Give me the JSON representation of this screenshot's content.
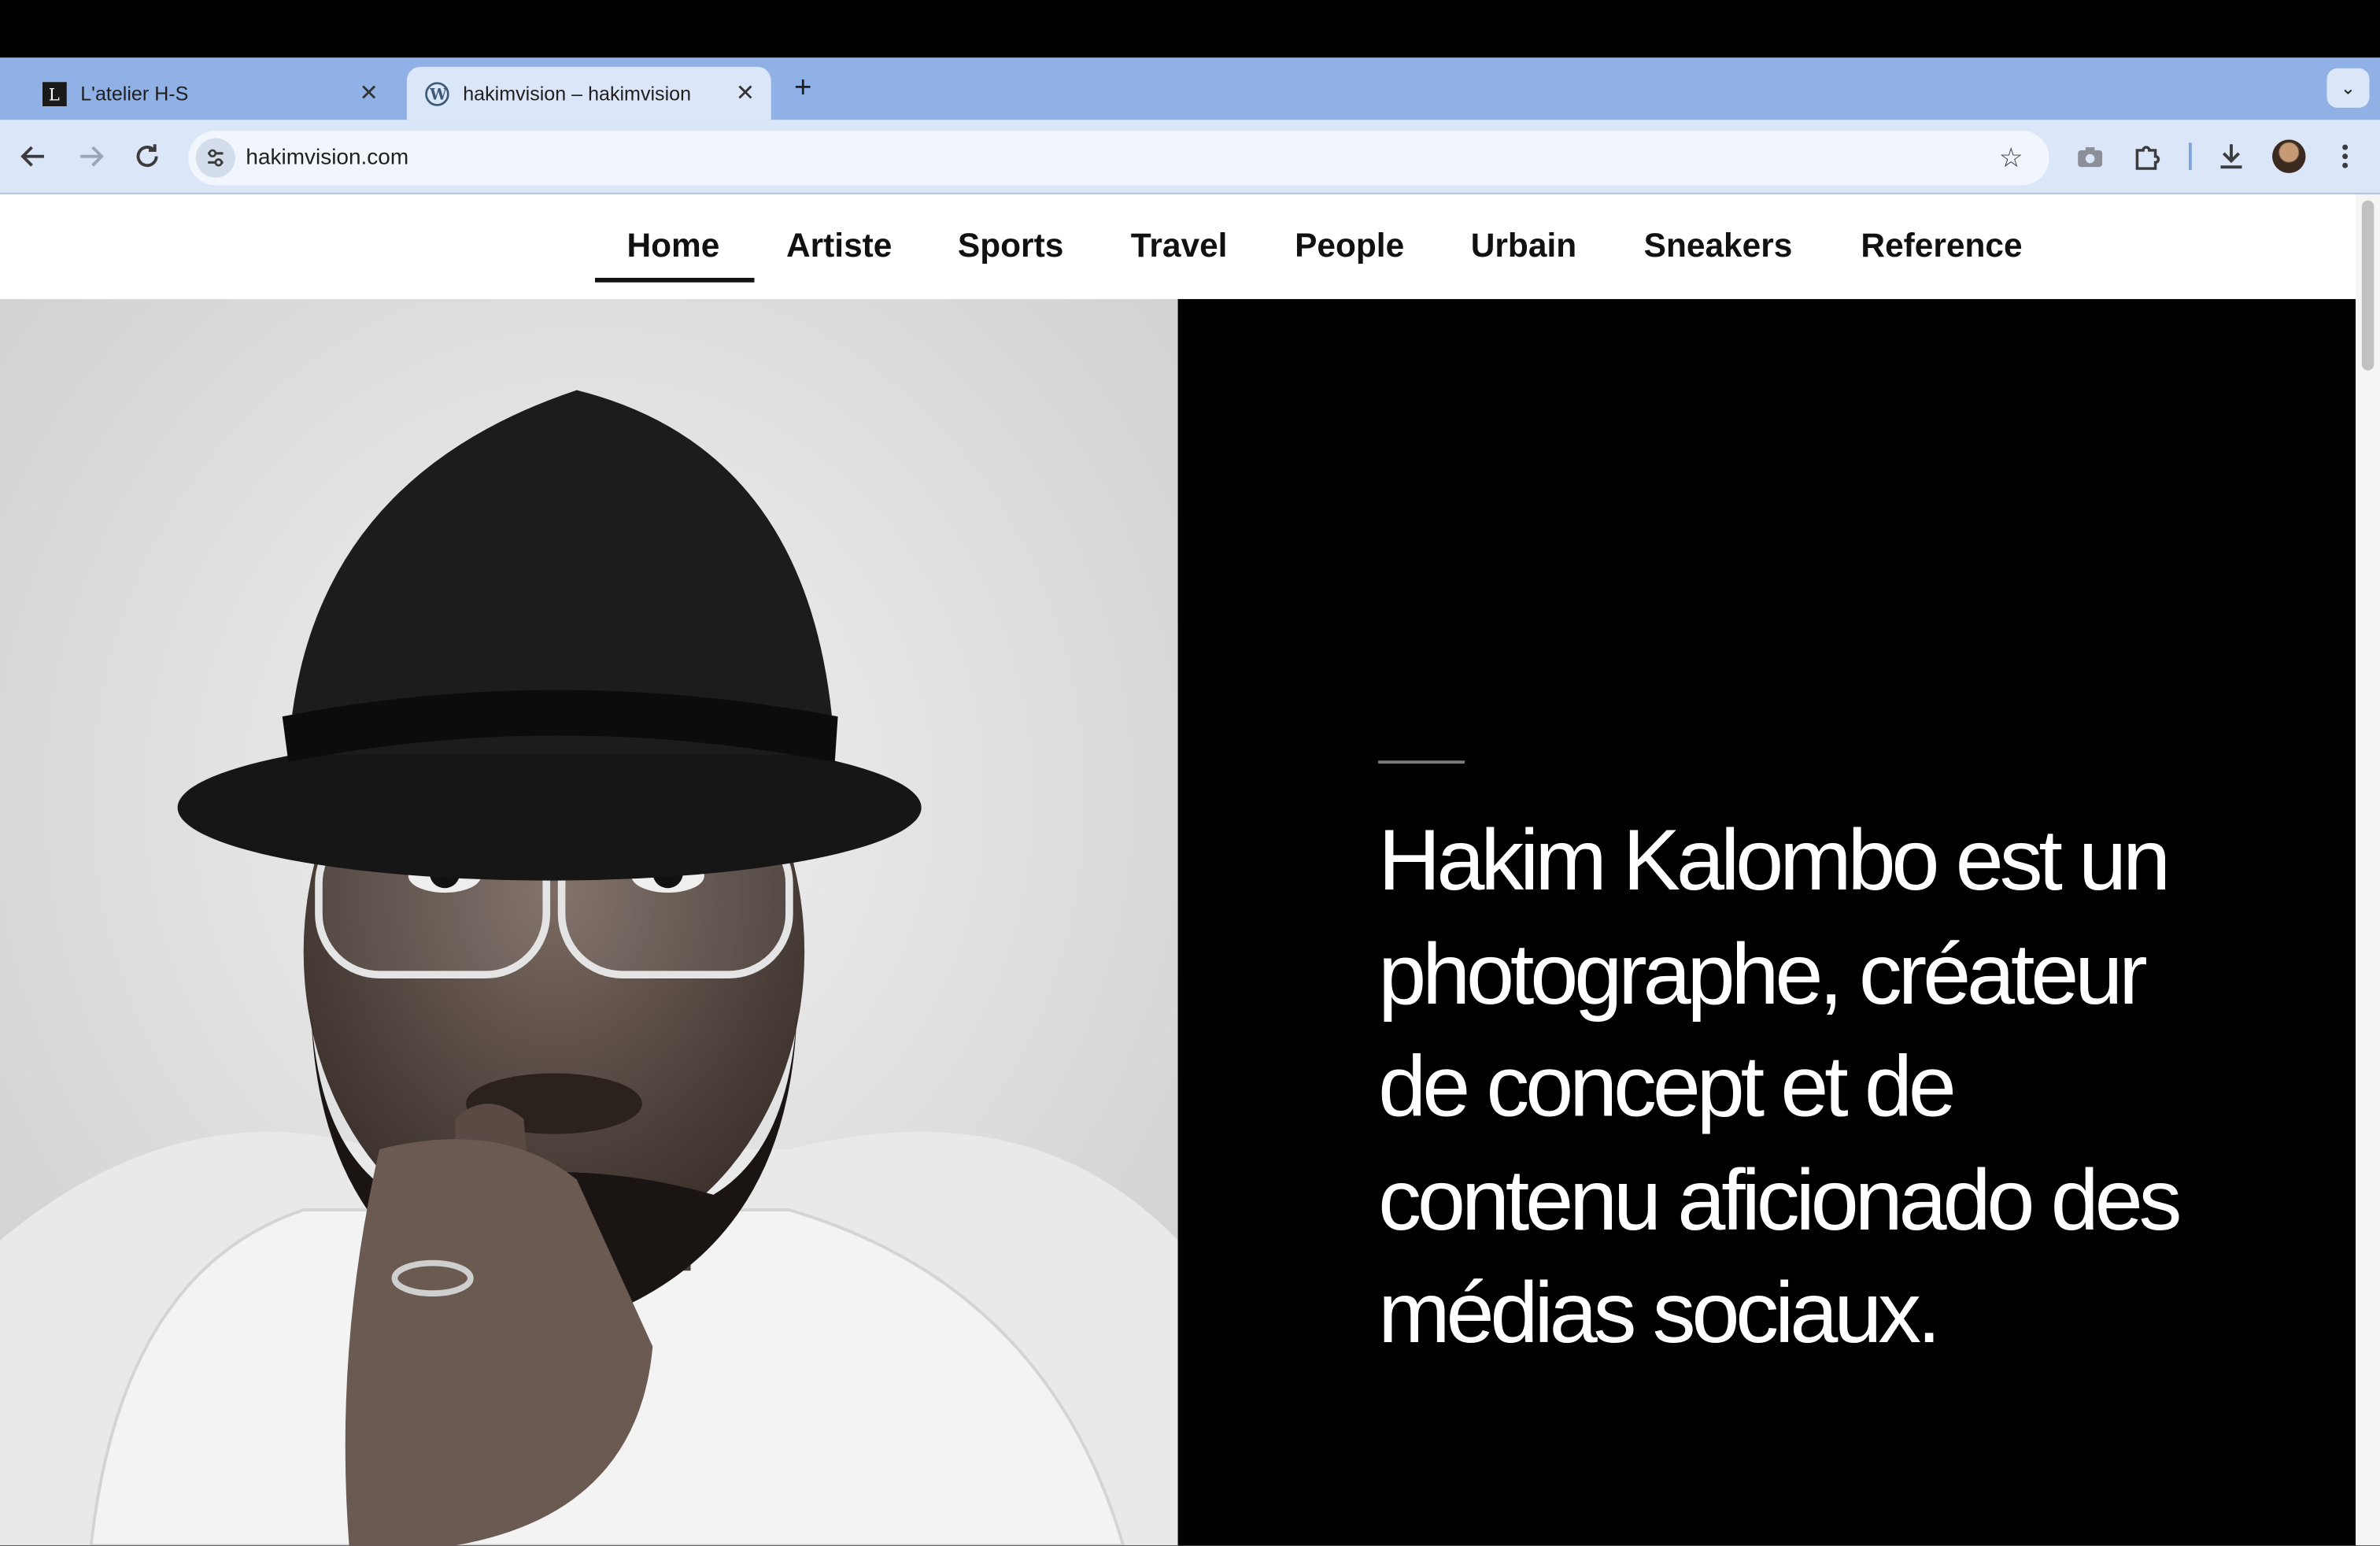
{
  "browser": {
    "tabs": [
      {
        "title": "L'atelier H-S",
        "active": false,
        "favicon": "atelier-logo-icon"
      },
      {
        "title": "hakimvision – hakimvision",
        "active": true,
        "favicon": "wordpress-icon"
      }
    ],
    "address": "hakimvision.com"
  },
  "site": {
    "nav": [
      {
        "label": "Home",
        "active": true
      },
      {
        "label": "Artiste"
      },
      {
        "label": "Sports"
      },
      {
        "label": "Travel"
      },
      {
        "label": "People"
      },
      {
        "label": "Urbain"
      },
      {
        "label": "Sneakers"
      },
      {
        "label": "Reference"
      }
    ],
    "hero": {
      "intro": "Hakim Kalombo est un photographe, créateur de concept et de contenu aficionado des médias sociaux.",
      "photo_icon": "portrait-photo"
    }
  },
  "colors": {
    "tabstrip": "#8fb1e6",
    "toolbar": "#dbe6f8",
    "hero_dark": "#000000"
  }
}
